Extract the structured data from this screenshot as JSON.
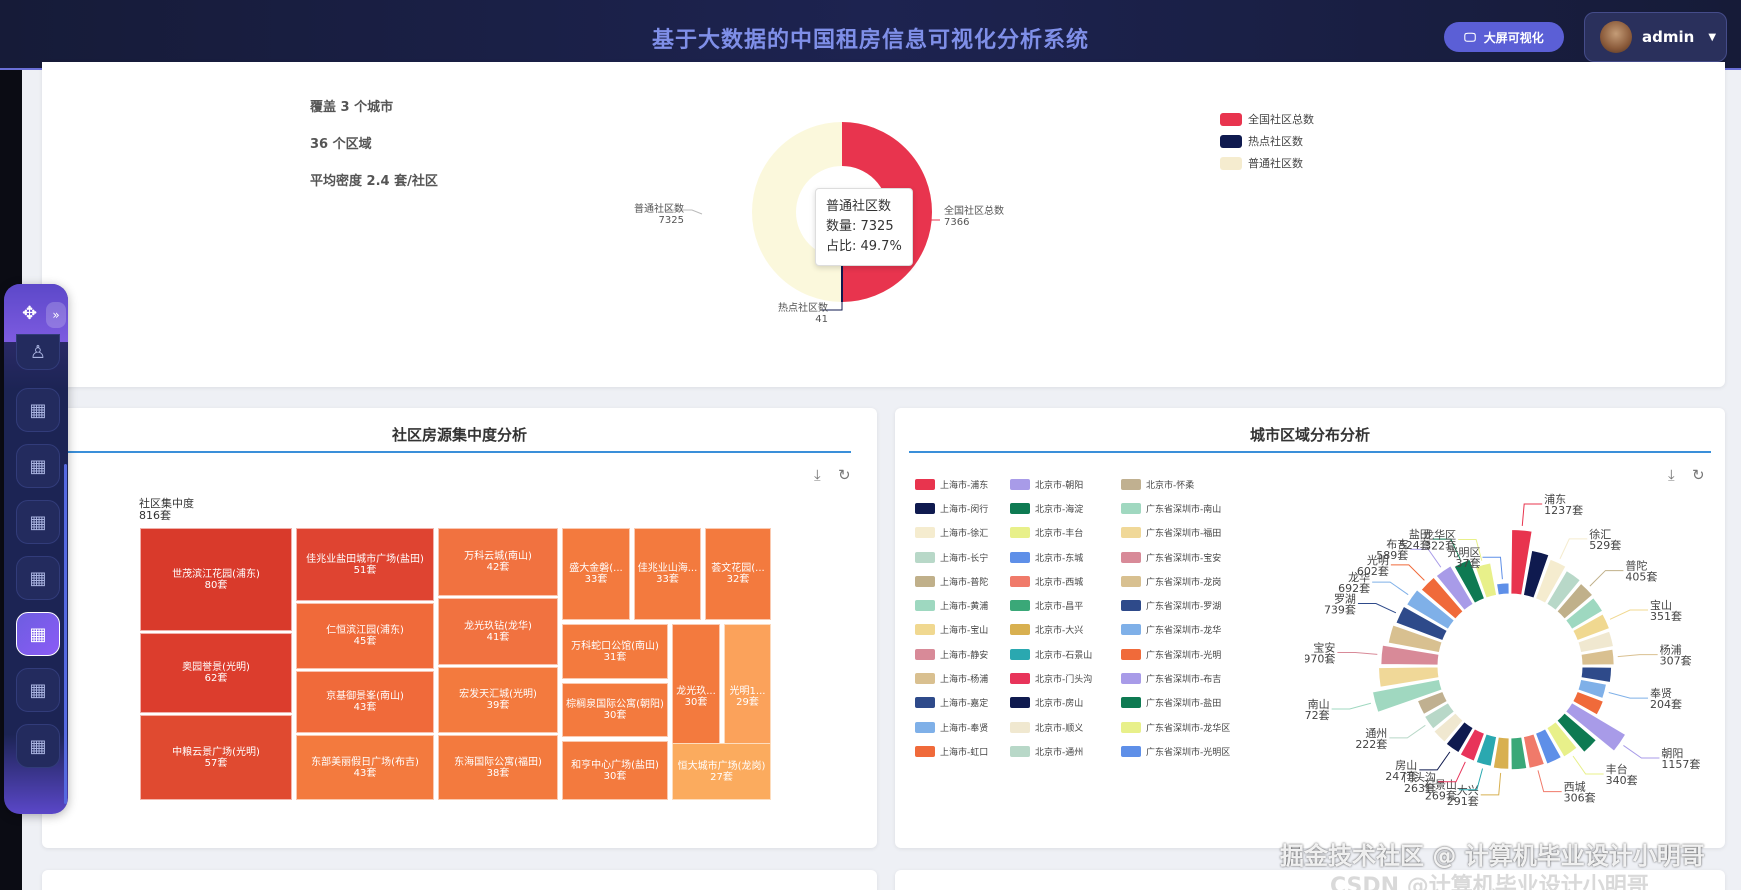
{
  "header": {
    "title": "基于大数据的中国租房信息可视化分析系统",
    "bigscreen_label": "大屏可视化",
    "user": "admin"
  },
  "stats": {
    "cities": "覆盖 3 个城市",
    "districts": "36 个区域",
    "density": "平均密度 2.4 套/社区"
  },
  "community_pie": {
    "tooltip": {
      "name": "普通社区数",
      "count": "数量: 7325",
      "share": "占比: 49.7%"
    },
    "labels": [
      {
        "name": "全国社区总数",
        "value": "7366"
      },
      {
        "name": "热点社区数",
        "value": "41"
      },
      {
        "name": "普通社区数",
        "value": "7325"
      }
    ],
    "legend": [
      {
        "name": "全国社区总数",
        "color": "#e8344e"
      },
      {
        "name": "热点社区数",
        "color": "#0f1a4f"
      },
      {
        "name": "普通社区数",
        "color": "#f5eccf"
      }
    ]
  },
  "treemap_card": {
    "title": "社区房源集中度分析",
    "root_label": "社区集中度",
    "root_value": "816套",
    "cells": [
      {
        "name": "世茂滨江花园(浦东)",
        "value": "80套"
      },
      {
        "name": "奥园誉景(光明)",
        "value": "62套"
      },
      {
        "name": "中粮云景广场(光明)",
        "value": "57套"
      },
      {
        "name": "佳兆业盐田城市广场(盐田)",
        "value": "51套"
      },
      {
        "name": "仁恒滨江园(浦东)",
        "value": "45套"
      },
      {
        "name": "京基御景峯(南山)",
        "value": "43套"
      },
      {
        "name": "东部美丽假日广场(布吉)",
        "value": "43套"
      },
      {
        "name": "万科云城(南山)",
        "value": "42套"
      },
      {
        "name": "龙光玖钻(龙华)",
        "value": "41套"
      },
      {
        "name": "宏发天汇城(光明)",
        "value": "39套"
      },
      {
        "name": "东海国际公寓(福田)",
        "value": "38套"
      },
      {
        "name": "盛大金磐(...",
        "value": "33套"
      },
      {
        "name": "佳兆业山海...",
        "value": "33套"
      },
      {
        "name": "荟文花园(...",
        "value": "32套"
      },
      {
        "name": "万科蛇口公馆(南山)",
        "value": "31套"
      },
      {
        "name": "棕榈泉国际公寓(朝阳)",
        "value": "30套"
      },
      {
        "name": "和亨中心广场(盐田)",
        "value": "30套"
      },
      {
        "name": "龙光玖...",
        "value": "30套"
      },
      {
        "name": "光明1...",
        "value": "29套"
      },
      {
        "name": "恒大城市广场(龙岗)",
        "value": "27套"
      }
    ]
  },
  "region_card": {
    "title": "城市区域分布分析",
    "legend": [
      {
        "name": "上海市-浦东",
        "color": "#e8344e"
      },
      {
        "name": "上海市-闵行",
        "color": "#0f1a4f"
      },
      {
        "name": "上海市-徐汇",
        "color": "#f5eccf"
      },
      {
        "name": "上海市-长宁",
        "color": "#b8d8c8"
      },
      {
        "name": "上海市-普陀",
        "color": "#c0b08a"
      },
      {
        "name": "上海市-黄浦",
        "color": "#9ed8c0"
      },
      {
        "name": "上海市-宝山",
        "color": "#f0d890"
      },
      {
        "name": "上海市-静安",
        "color": "#d88a98"
      },
      {
        "name": "上海市-杨浦",
        "color": "#d9c090"
      },
      {
        "name": "上海市-嘉定",
        "color": "#2e4a8a"
      },
      {
        "name": "上海市-奉贤",
        "color": "#7fb0e8"
      },
      {
        "name": "上海市-虹口",
        "color": "#f06a3a"
      },
      {
        "name": "北京市-朝阳",
        "color": "#a89be8"
      },
      {
        "name": "北京市-海淀",
        "color": "#0e7a52"
      },
      {
        "name": "北京市-丰台",
        "color": "#e8f08a"
      },
      {
        "name": "北京市-东城",
        "color": "#5e8fe8"
      },
      {
        "name": "北京市-西城",
        "color": "#f07a6a"
      },
      {
        "name": "北京市-昌平",
        "color": "#3aa878"
      },
      {
        "name": "北京市-大兴",
        "color": "#d8b050"
      },
      {
        "name": "北京市-石景山",
        "color": "#2aa8b0"
      },
      {
        "name": "北京市-门头沟",
        "color": "#e8345a"
      },
      {
        "name": "北京市-房山",
        "color": "#0f1a4f"
      },
      {
        "name": "北京市-顺义",
        "color": "#f0e8d0"
      },
      {
        "name": "北京市-通州",
        "color": "#b8d8c8"
      },
      {
        "name": "北京市-怀柔",
        "color": "#c0b090"
      },
      {
        "name": "广东省深圳市-南山",
        "color": "#a0d8c0"
      },
      {
        "name": "广东省深圳市-福田",
        "color": "#f0d898"
      },
      {
        "name": "广东省深圳市-宝安",
        "color": "#d88a98"
      },
      {
        "name": "广东省深圳市-龙岗",
        "color": "#d8c090"
      },
      {
        "name": "广东省深圳市-罗湖",
        "color": "#2e4a8a"
      },
      {
        "name": "广东省深圳市-龙华",
        "color": "#7fb0e8"
      },
      {
        "name": "广东省深圳市-光明",
        "color": "#f06a3a"
      },
      {
        "name": "广东省深圳市-布吉",
        "color": "#a89be8"
      },
      {
        "name": "广东省深圳市-盐田",
        "color": "#0e7a52"
      },
      {
        "name": "广东省深圳市-龙华区",
        "color": "#e8f08a"
      },
      {
        "name": "广东省深圳市-光明区",
        "color": "#5e8fe8"
      }
    ],
    "rose": [
      {
        "name": "浦东",
        "value": 1237,
        "label": "1237套",
        "color": "#e8344e"
      },
      {
        "name": "闵行",
        "value": 620,
        "color": "#0f1a4f"
      },
      {
        "name": "徐汇",
        "value": 529,
        "label": "529套",
        "color": "#f5eccf"
      },
      {
        "name": "长宁",
        "value": 450,
        "color": "#b8d8c8"
      },
      {
        "name": "普陀",
        "value": 405,
        "label": "405套",
        "color": "#c0b08a"
      },
      {
        "name": "黄浦",
        "value": 380,
        "color": "#9ed8c0"
      },
      {
        "name": "宝山",
        "value": 351,
        "label": "351套",
        "color": "#f0d890"
      },
      {
        "name": "静安",
        "value": 330,
        "color": "#f0e8d0"
      },
      {
        "name": "杨浦",
        "value": 307,
        "label": "307套",
        "color": "#d9c090"
      },
      {
        "name": "嘉定",
        "value": 260,
        "color": "#2e4a8a"
      },
      {
        "name": "奉贤",
        "value": 204,
        "label": "204套",
        "color": "#7fb0e8"
      },
      {
        "name": "虹口",
        "value": 230,
        "color": "#f06a3a"
      },
      {
        "name": "朝阳",
        "value": 1157,
        "label": "1157套",
        "color": "#a89be8"
      },
      {
        "name": "海淀",
        "value": 520,
        "color": "#0e7a52"
      },
      {
        "name": "丰台",
        "value": 340,
        "label": "340套",
        "color": "#e8f08a"
      },
      {
        "name": "东城",
        "value": 320,
        "color": "#5e8fe8"
      },
      {
        "name": "西城",
        "value": 306,
        "label": "306套",
        "color": "#f07a6a"
      },
      {
        "name": "昌平",
        "value": 300,
        "color": "#3aa878"
      },
      {
        "name": "大兴",
        "value": 291,
        "label": "291套",
        "color": "#d8b050"
      },
      {
        "name": "石景山",
        "value": 269,
        "label": "269套",
        "color": "#2aa8b0"
      },
      {
        "name": "门头沟",
        "value": 263,
        "label": "263套",
        "color": "#e8345a"
      },
      {
        "name": "房山",
        "value": 247,
        "label": "247套",
        "color": "#0f1a4f"
      },
      {
        "name": "顺义",
        "value": 240,
        "color": "#f0e8d0"
      },
      {
        "name": "通州",
        "value": 222,
        "label": "222套",
        "color": "#b8d8c8"
      },
      {
        "name": "怀柔",
        "value": 215,
        "color": "#c0b090"
      },
      {
        "name": "南山",
        "value": 1372,
        "label": "1372套",
        "color": "#a0d8c0"
      },
      {
        "name": "福田",
        "value": 1050,
        "color": "#f0d898"
      },
      {
        "name": "宝安",
        "value": 970,
        "label": "970套",
        "color": "#d88a98"
      },
      {
        "name": "龙岗",
        "value": 800,
        "color": "#d8c090"
      },
      {
        "name": "罗湖",
        "value": 739,
        "label": "739套",
        "color": "#2e4a8a"
      },
      {
        "name": "龙华",
        "value": 692,
        "label": "692套",
        "color": "#7fb0e8"
      },
      {
        "name": "光明",
        "value": 602,
        "label": "602套",
        "color": "#f06a3a"
      },
      {
        "name": "布吉",
        "value": 589,
        "label": "589套",
        "color": "#a89be8"
      },
      {
        "name": "盐田",
        "value": 524,
        "label": "524套",
        "color": "#0e7a52"
      },
      {
        "name": "龙华区",
        "value": 322,
        "label": "322套",
        "color": "#e8f08a"
      },
      {
        "name": "光明区",
        "value": 37,
        "label": "37套",
        "color": "#5e8fe8"
      }
    ]
  },
  "watermark": "掘金技术社区 @ 计算机毕业设计小明哥",
  "watermark2": "CSDN @计算机毕业设计小明哥"
}
